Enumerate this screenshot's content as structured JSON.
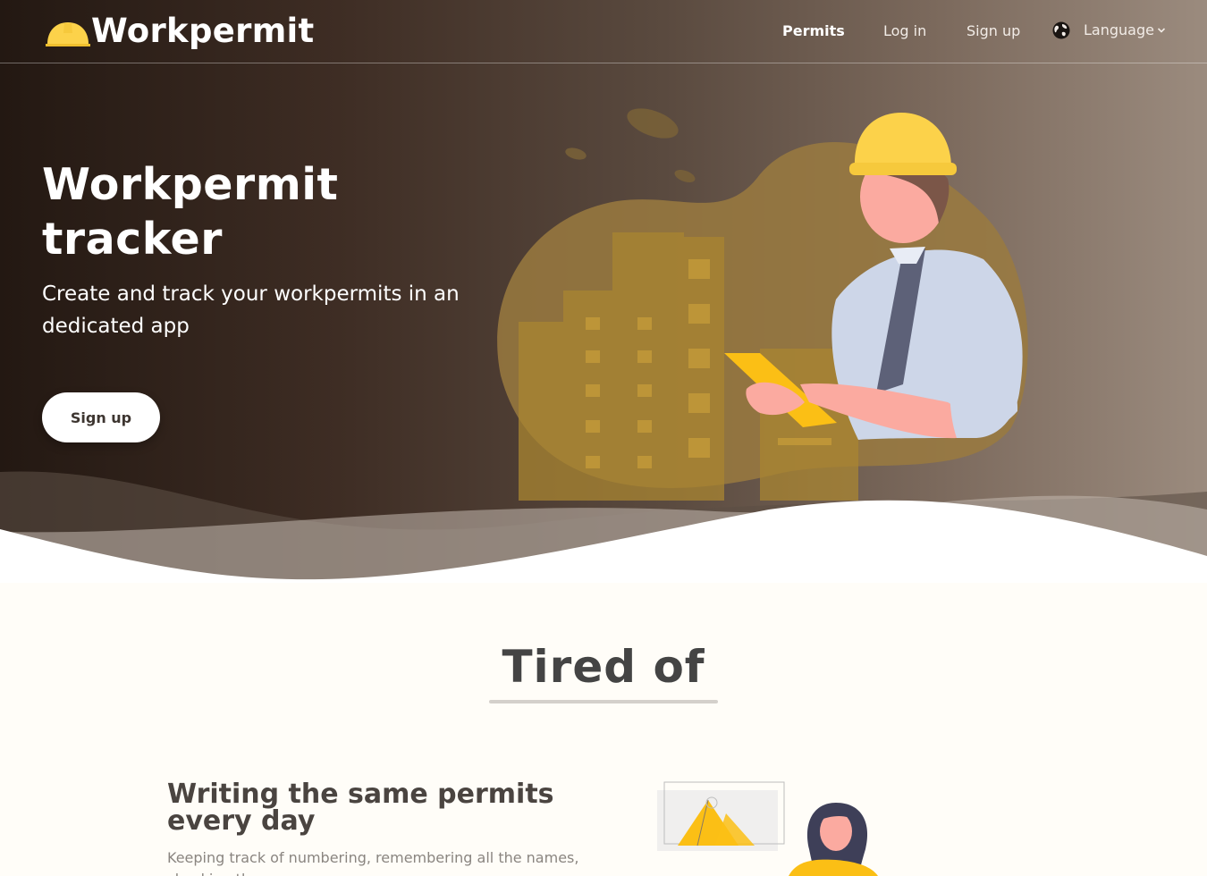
{
  "navbar": {
    "brand": "Workpermit",
    "links": {
      "permits": "Permits",
      "login": "Log in",
      "signup": "Sign up",
      "language": "Language"
    },
    "icons": [
      "hardhat-icon",
      "globe-icon",
      "chevron-down-icon"
    ]
  },
  "hero": {
    "title": "Workpermit tracker",
    "subtitle": "Create and track your workpermits in an dedicated app",
    "cta": "Sign up"
  },
  "section": {
    "title": "Tired of",
    "feature": {
      "heading": "Writing the same permits every day",
      "text": "Keeping track of numbering, remembering all the names, checking the prev..."
    }
  },
  "colors": {
    "hero_dark": "#231812",
    "hero_light": "#9b8b7e",
    "accent_yellow": "#fcd24a",
    "page_bg": "#fffdf8",
    "text_dark": "#444444"
  }
}
